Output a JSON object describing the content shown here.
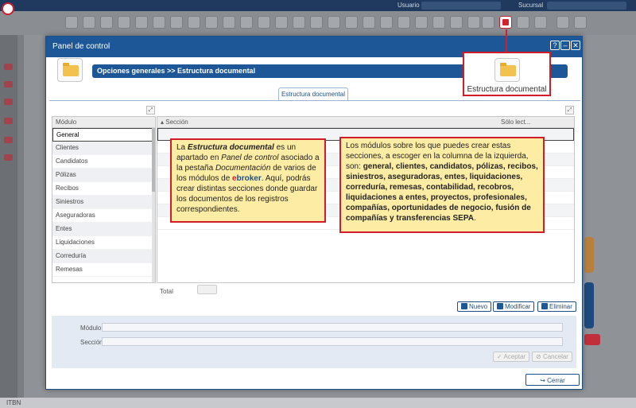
{
  "app": {
    "top_labels": {
      "user": "Usuario",
      "branch": "Sucursal"
    },
    "bottom_label": "ITBN"
  },
  "modal": {
    "title": "Panel de control",
    "help_btn": "?",
    "min_btn": "–",
    "close_btn": "✕",
    "breadcrumb": "Opciones generales >> Estructura documental",
    "tab": "Estructura documental"
  },
  "modules": {
    "header": "Módulo",
    "items": [
      "General",
      "Clientes",
      "Candidatos",
      "Pólizas",
      "Recibos",
      "Siniestros",
      "Aseguradoras",
      "Entes",
      "Liquidaciones",
      "Correduría",
      "Remesas"
    ],
    "selected_index": 0
  },
  "sections": {
    "header_section": "Sección",
    "header_readonly": "Sólo lect..."
  },
  "total_label": "Total",
  "actions": {
    "new": "Nuevo",
    "edit": "Modificar",
    "delete": "Eliminar"
  },
  "form": {
    "module_label": "Módulo",
    "section_label": "Sección",
    "accept": "Aceptar",
    "cancel": "Cancelar"
  },
  "close_label": "Cerrar",
  "zoom": {
    "label": "Estructura documental"
  },
  "callout_left": {
    "p1": "La ",
    "b1": "Estructura documental",
    "p2": " es un apartado en ",
    "i1": "Panel de control",
    "p3": " asociado a la pestaña ",
    "i2": "Documentación",
    "p4": " de varios de los módulos de ",
    "brand_e": "e",
    "brand_rest": "broker",
    "p5": ". Aquí, podrás crear distintas secciones donde guardar los documentos de los registros correspondientes."
  },
  "callout_right": {
    "p1": "Los módulos sobre los que puedes crear estas secciones, a escoger en la columna de la izquierda, son: ",
    "b1": "general, clientes, candidatos, pólizas, recibos, siniestros, aseguradoras, entes, liquidaciones, correduría, remesas, contabilidad, recobros, liquidaciones a entes, proyectos, profesionales, compañías, oportunidades de negocio, fusión de compañías y transferencias SEPA",
    "p2": "."
  },
  "colors": {
    "accent": "#1e5797",
    "highlight": "#d11c2a",
    "callout_bg": "#fdeda4"
  }
}
